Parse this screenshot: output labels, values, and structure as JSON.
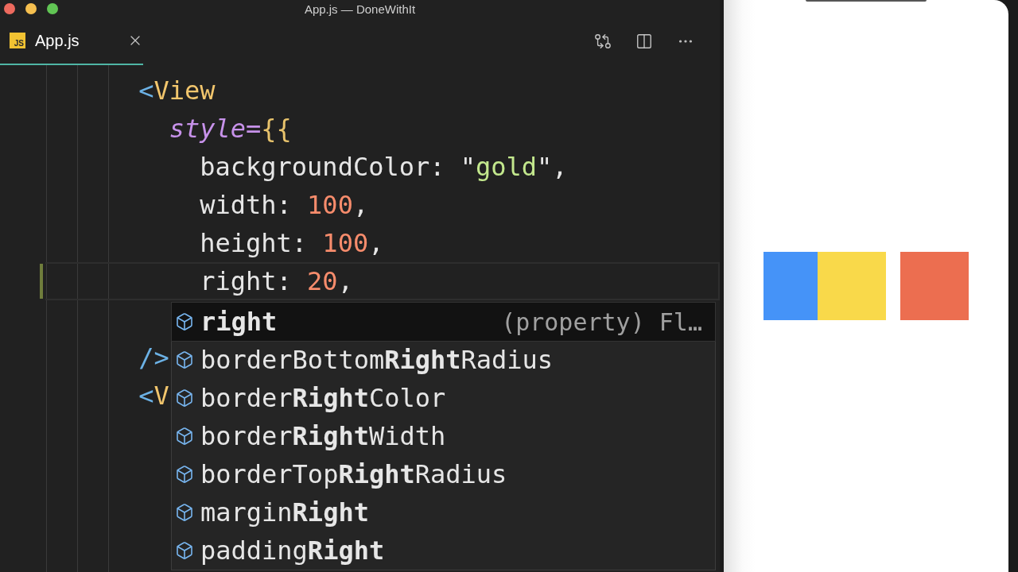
{
  "window": {
    "title": "App.js — DoneWithIt"
  },
  "tabs": [
    {
      "badge": "JS",
      "label": "App.js",
      "selected": true
    }
  ],
  "code_lines": [
    {
      "kind": "tag",
      "current": false,
      "modified": false,
      "tokens": [
        {
          "kind": "bracket",
          "text": "<"
        },
        {
          "kind": "tag",
          "text": "View"
        }
      ]
    },
    {
      "kind": "attribute",
      "current": false,
      "modified": false,
      "tokens": [
        {
          "kind": "attr",
          "text": "style"
        },
        {
          "kind": "operator",
          "text": "="
        },
        {
          "kind": "brace",
          "text": "{{"
        }
      ]
    },
    {
      "kind": "property",
      "current": false,
      "modified": false,
      "tokens": [
        {
          "kind": "prop",
          "text": "backgroundColor"
        },
        {
          "kind": "punct",
          "text": ": \""
        },
        {
          "kind": "string",
          "text": "gold"
        },
        {
          "kind": "punct",
          "text": "\","
        }
      ]
    },
    {
      "kind": "property",
      "current": false,
      "modified": false,
      "tokens": [
        {
          "kind": "prop",
          "text": "width"
        },
        {
          "kind": "punct",
          "text": ": "
        },
        {
          "kind": "number",
          "text": "100"
        },
        {
          "kind": "punct",
          "text": ","
        }
      ]
    },
    {
      "kind": "property",
      "current": false,
      "modified": false,
      "tokens": [
        {
          "kind": "prop",
          "text": "height"
        },
        {
          "kind": "punct",
          "text": ": "
        },
        {
          "kind": "number",
          "text": "100"
        },
        {
          "kind": "punct",
          "text": ","
        }
      ]
    },
    {
      "kind": "property",
      "current": true,
      "modified": true,
      "tokens": [
        {
          "kind": "prop",
          "text": "right"
        },
        {
          "kind": "punct",
          "text": ": "
        },
        {
          "kind": "number",
          "text": "20"
        },
        {
          "kind": "punct",
          "text": ","
        }
      ]
    }
  ],
  "lines_beside_suggestions": [
    {
      "kind": "tag",
      "tokens": [
        {
          "kind": "bracket",
          "text": "/>"
        }
      ]
    },
    {
      "kind": "tag",
      "tokens": [
        {
          "kind": "bracket",
          "text": "<"
        },
        {
          "kind": "tag",
          "text": "V"
        }
      ]
    }
  ],
  "suggestions": [
    {
      "label": "**right**",
      "detail": "(property) Fl…",
      "selected": true
    },
    {
      "label": "borderBottom**Right**Radius",
      "selected": false
    },
    {
      "label": "border**Right**Color",
      "selected": false
    },
    {
      "label": "border**Right**Width",
      "selected": false
    },
    {
      "label": "borderTop**Right**Radius",
      "selected": false
    },
    {
      "label": "margin**Right**",
      "selected": false
    },
    {
      "label": "padding**Right**",
      "selected": false
    }
  ],
  "phone": {
    "boxes": [
      {
        "color": "#4593f8"
      },
      {
        "color": "#f9d94a"
      },
      {
        "color": "#ec6e50"
      }
    ]
  }
}
